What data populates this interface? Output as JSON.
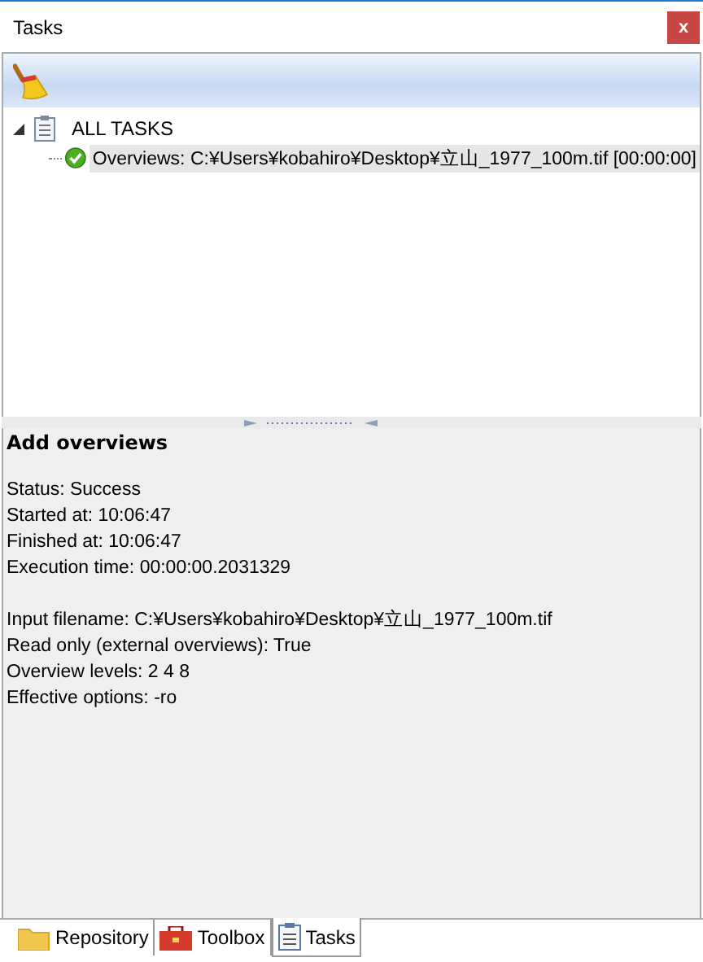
{
  "window": {
    "title": "Tasks",
    "close": "x"
  },
  "tree": {
    "label": "ALL TASKS",
    "expanded": true,
    "children": [
      {
        "label": "Overviews: C:¥Users¥kobahiro¥Desktop¥立山_1977_100m.tif [00:00:00]",
        "kind": "success",
        "selected": true
      }
    ]
  },
  "details": {
    "title": "Add overviews",
    "groups": [
      [
        "Status: Success",
        "Started at: 10:06:47",
        "Finished at: 10:06:47",
        "Execution time: 00:00:00.2031329"
      ],
      [
        "Input filename: C:¥Users¥kobahiro¥Desktop¥立山_1977_100m.tif",
        "Read only (external overviews): True",
        "Overview levels: 2 4 8",
        "Effective options: -ro"
      ]
    ]
  },
  "tabs": [
    {
      "label": "Repository",
      "kind": "folder",
      "selected": false
    },
    {
      "label": "Toolbox",
      "kind": "toolbox",
      "selected": false
    },
    {
      "label": "Tasks",
      "kind": "tasks",
      "selected": true
    }
  ]
}
